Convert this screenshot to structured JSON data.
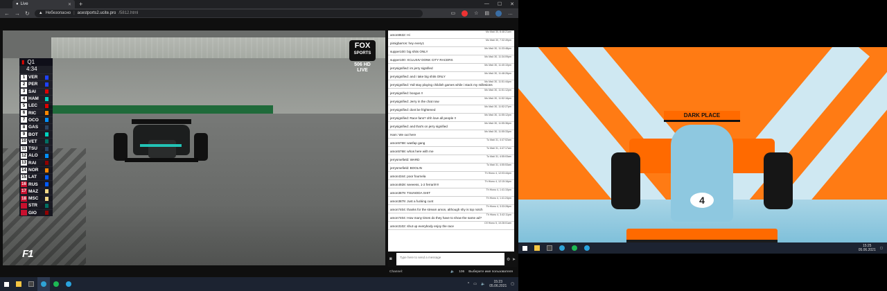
{
  "browser": {
    "tab_title": "Live",
    "address": {
      "security_label": "Небезопасно",
      "domain": "acestports2.ucite.pro",
      "path": "/5812.html"
    }
  },
  "video": {
    "session": "Q1",
    "clock": "4:34",
    "leaderboard": [
      {
        "pos": "1",
        "code": "VER",
        "team_color": "#1e41ff",
        "eliminated": false
      },
      {
        "pos": "2",
        "code": "PER",
        "team_color": "#1e41ff",
        "eliminated": false
      },
      {
        "pos": "3",
        "code": "SAI",
        "team_color": "#dc0000",
        "eliminated": false
      },
      {
        "pos": "4",
        "code": "HAM",
        "team_color": "#00d2be",
        "eliminated": false
      },
      {
        "pos": "5",
        "code": "LEC",
        "team_color": "#dc0000",
        "eliminated": false
      },
      {
        "pos": "6",
        "code": "RIC",
        "team_color": "#ff8700",
        "eliminated": false
      },
      {
        "pos": "7",
        "code": "OCO",
        "team_color": "#0090ff",
        "eliminated": false
      },
      {
        "pos": "8",
        "code": "GAS",
        "team_color": "#2b4562",
        "eliminated": false
      },
      {
        "pos": "9",
        "code": "BOT",
        "team_color": "#00d2be",
        "eliminated": false
      },
      {
        "pos": "10",
        "code": "VET",
        "team_color": "#006f62",
        "eliminated": false
      },
      {
        "pos": "11",
        "code": "TSU",
        "team_color": "#2b4562",
        "eliminated": false
      },
      {
        "pos": "12",
        "code": "ALO",
        "team_color": "#0090ff",
        "eliminated": false
      },
      {
        "pos": "13",
        "code": "RAI",
        "team_color": "#900000",
        "eliminated": false
      },
      {
        "pos": "14",
        "code": "NOR",
        "team_color": "#ff8700",
        "eliminated": false
      },
      {
        "pos": "15",
        "code": "LAT",
        "team_color": "#005aff",
        "eliminated": false
      },
      {
        "pos": "16",
        "code": "RUS",
        "team_color": "#005aff",
        "eliminated": true
      },
      {
        "pos": "17",
        "code": "MAZ",
        "team_color": "#f0d787",
        "eliminated": true
      },
      {
        "pos": "18",
        "code": "MSC",
        "team_color": "#f0d787",
        "eliminated": true
      },
      {
        "pos": "",
        "code": "STR",
        "team_color": "#006f62",
        "eliminated": true
      },
      {
        "pos": "",
        "code": "GIO",
        "team_color": "#900000",
        "eliminated": true
      }
    ],
    "broadcaster": "FOX",
    "broadcaster_sub": "SPORTS",
    "channel_number": "506 HD",
    "channel_live": "LIVE",
    "f1_logo": "F1"
  },
  "chat": {
    "messages": [
      {
        "ts": "Mo Maö 30, 8:48:21am",
        "text": "amon8632: Hi"
      },
      {
        "ts": "Mo Maö 30, 7:32:49pm",
        "text": "pimigbarros: hey every1"
      },
      {
        "ts": "Mo Maö 30, 11:33:48pm",
        "text": "supper100: big shits ONLY"
      },
      {
        "ts": "Mo Maö 30, 11:34:09pm",
        "text": "supper100: XCLUSIV DONK CITY RACERS"
      },
      {
        "ts": "Mo Maö 30, 11:40:10pm",
        "text": "jerrysignified: im jerry signified"
      },
      {
        "ts": "Mo Maö 30, 11:48:26pm",
        "text": "jerrysignified: and i take big shits ONLY"
      },
      {
        "ts": "Mo Maö 30, 11:51:44pm",
        "text": "jerrysignified: Yall stay playing childish games while i stack my millesions"
      },
      {
        "ts": "Mo Maö 30, 11:51:12pm",
        "text": "jerrysignified: boogus !!"
      },
      {
        "ts": "Mo Maö 30, 11:52:16pm",
        "text": "jerrysignified: Jerry in the chat now"
      },
      {
        "ts": "Mo Maö 30, 11:52:27pm",
        "text": "jerrysignified: dont be frightened"
      },
      {
        "ts": "Mo Maö 30, 11:55:12pm",
        "text": "jerrysignified: Race fans? ohh love all people !!"
      },
      {
        "ts": "Mo Maö 30, 11:55:36pm",
        "text": "jerrysignified: and that's on jerry signified"
      },
      {
        "ts": "Mo Maö 30, 11:55:33pm",
        "text": "Ham: We out here"
      },
      {
        "ts": "Tu Maö 31, 4:47:02am",
        "text": "amon5768: wasfap gang"
      },
      {
        "ts": "Tu Maö 31, 4:47:17am",
        "text": "amon5768: whos here with me"
      },
      {
        "ts": "Tu Maö 31, 4:55:03am",
        "text": "jerrysmefield: WARD"
      },
      {
        "ts": "Tu Maö 31, 4:55:53am",
        "text": "jerrysmefield: BOOLIN"
      },
      {
        "ts": "Th Hionu 4, 12:03:44pm",
        "text": "amon4344: poor fournela"
      },
      {
        "ts": "Th Hionu 4, 12:15:16pm",
        "text": "amon4928: seeeess, 1-2 ferrari!!!!!"
      },
      {
        "ts": "Th Hionu 4, 1:41:10pm",
        "text": "amon3879: TSUNODA SHIT"
      },
      {
        "ts": "Th Hionu 4, 1:41:24pm",
        "text": "amon3879: Just a fucking cunt"
      },
      {
        "ts": "Th Hionu 4, 3:33:28pm",
        "text": "amon7404: thanks for the stream amon, although shy is top notch"
      },
      {
        "ts": "Th Hionu 4, 3:42:11pm",
        "text": "amon7404: How many times do they have to show the same ad?"
      },
      {
        "ts": "Cб Hionu 5, 10:28:01am",
        "text": "amon3102: shut up everybody enjoy the race"
      }
    ],
    "input_placeholder": "Type here to send a message",
    "controls_label": "Channel:",
    "viewers": "106",
    "select_user": "Выберите имя пользователя"
  },
  "taskbar_left": {
    "time": "15:23",
    "date": "05.06.2021"
  },
  "taskbar_right": {
    "time": "15:25",
    "date": "05.06.2021"
  },
  "wallpaper": {
    "car_number": "4",
    "sponsor": "DARK PLACE"
  }
}
